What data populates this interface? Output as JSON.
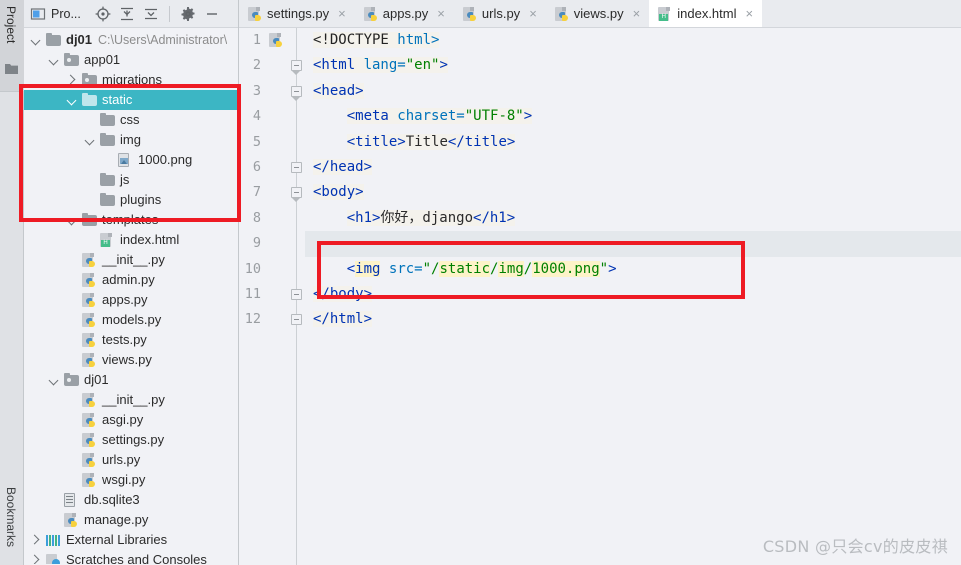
{
  "left_strip": {
    "project_label": "Project",
    "bookmarks_label": "Bookmarks",
    "folder_icon": "folder-icon"
  },
  "project_panel": {
    "title": "Pro...",
    "toolbar": [
      {
        "name": "project-view-icon",
        "glyph": "project-window-icon"
      },
      {
        "name": "select-opened-file-icon",
        "glyph": "target-icon"
      },
      {
        "name": "expand-all-icon",
        "glyph": "expand-all-icon"
      },
      {
        "name": "collapse-all-icon",
        "glyph": "collapse-all-icon"
      },
      {
        "name": "settings-icon",
        "glyph": "gear-icon"
      },
      {
        "name": "hide-icon",
        "glyph": "minimize-icon"
      }
    ],
    "tree": [
      {
        "label": "dj01",
        "sub": "C:\\Users\\Administrator\\",
        "indent": 0,
        "icon": "folder",
        "arrow": "down",
        "bold": true,
        "selected": false
      },
      {
        "label": "app01",
        "sub": "",
        "indent": 1,
        "icon": "folder-src",
        "arrow": "down",
        "bold": false,
        "selected": false
      },
      {
        "label": "migrations",
        "sub": "",
        "indent": 2,
        "icon": "folder-src",
        "arrow": "right",
        "bold": false,
        "selected": false
      },
      {
        "label": "static",
        "sub": "",
        "indent": 2,
        "icon": "folder",
        "arrow": "down",
        "bold": false,
        "selected": true
      },
      {
        "label": "css",
        "sub": "",
        "indent": 3,
        "icon": "folder",
        "arrow": "none",
        "bold": false,
        "selected": false
      },
      {
        "label": "img",
        "sub": "",
        "indent": 3,
        "icon": "folder",
        "arrow": "down",
        "bold": false,
        "selected": false
      },
      {
        "label": "1000.png",
        "sub": "",
        "indent": 4,
        "icon": "image",
        "arrow": "none",
        "bold": false,
        "selected": false
      },
      {
        "label": "js",
        "sub": "",
        "indent": 3,
        "icon": "folder",
        "arrow": "none",
        "bold": false,
        "selected": false
      },
      {
        "label": "plugins",
        "sub": "",
        "indent": 3,
        "icon": "folder",
        "arrow": "none",
        "bold": false,
        "selected": false
      },
      {
        "label": "templates",
        "sub": "",
        "indent": 2,
        "icon": "folder",
        "arrow": "down",
        "bold": false,
        "selected": false
      },
      {
        "label": "index.html",
        "sub": "",
        "indent": 3,
        "icon": "html",
        "arrow": "none",
        "bold": false,
        "selected": false
      },
      {
        "label": "__init__.py",
        "sub": "",
        "indent": 2,
        "icon": "python",
        "arrow": "none",
        "bold": false,
        "selected": false
      },
      {
        "label": "admin.py",
        "sub": "",
        "indent": 2,
        "icon": "python",
        "arrow": "none",
        "bold": false,
        "selected": false
      },
      {
        "label": "apps.py",
        "sub": "",
        "indent": 2,
        "icon": "python",
        "arrow": "none",
        "bold": false,
        "selected": false
      },
      {
        "label": "models.py",
        "sub": "",
        "indent": 2,
        "icon": "python",
        "arrow": "none",
        "bold": false,
        "selected": false
      },
      {
        "label": "tests.py",
        "sub": "",
        "indent": 2,
        "icon": "python",
        "arrow": "none",
        "bold": false,
        "selected": false
      },
      {
        "label": "views.py",
        "sub": "",
        "indent": 2,
        "icon": "python",
        "arrow": "none",
        "bold": false,
        "selected": false
      },
      {
        "label": "dj01",
        "sub": "",
        "indent": 1,
        "icon": "folder-src",
        "arrow": "down",
        "bold": false,
        "selected": false
      },
      {
        "label": "__init__.py",
        "sub": "",
        "indent": 2,
        "icon": "python",
        "arrow": "none",
        "bold": false,
        "selected": false
      },
      {
        "label": "asgi.py",
        "sub": "",
        "indent": 2,
        "icon": "python",
        "arrow": "none",
        "bold": false,
        "selected": false
      },
      {
        "label": "settings.py",
        "sub": "",
        "indent": 2,
        "icon": "python",
        "arrow": "none",
        "bold": false,
        "selected": false
      },
      {
        "label": "urls.py",
        "sub": "",
        "indent": 2,
        "icon": "python",
        "arrow": "none",
        "bold": false,
        "selected": false
      },
      {
        "label": "wsgi.py",
        "sub": "",
        "indent": 2,
        "icon": "python",
        "arrow": "none",
        "bold": false,
        "selected": false
      },
      {
        "label": "db.sqlite3",
        "sub": "",
        "indent": 1,
        "icon": "db",
        "arrow": "none",
        "bold": false,
        "selected": false
      },
      {
        "label": "manage.py",
        "sub": "",
        "indent": 1,
        "icon": "python",
        "arrow": "none",
        "bold": false,
        "selected": false
      },
      {
        "label": "External Libraries",
        "sub": "",
        "indent": 0,
        "icon": "library",
        "arrow": "right",
        "bold": false,
        "selected": false
      },
      {
        "label": "Scratches and Consoles",
        "sub": "",
        "indent": 0,
        "icon": "scratches",
        "arrow": "right",
        "bold": false,
        "selected": false
      }
    ]
  },
  "editor": {
    "tabs": [
      {
        "label": "settings.py",
        "icon": "python-file-icon",
        "active": false,
        "close": "×"
      },
      {
        "label": "apps.py",
        "icon": "python-file-icon",
        "active": false,
        "close": "×"
      },
      {
        "label": "urls.py",
        "icon": "python-file-icon",
        "active": false,
        "close": "×"
      },
      {
        "label": "views.py",
        "icon": "python-file-icon",
        "active": false,
        "close": "×"
      },
      {
        "label": "index.html",
        "icon": "html-file-icon",
        "active": true,
        "close": "×"
      }
    ],
    "line_numbers": [
      "1",
      "2",
      "3",
      "4",
      "5",
      "6",
      "7",
      "8",
      "9",
      "10",
      "11",
      "12"
    ],
    "current_line": 9,
    "code_lines": [
      {
        "n": 1,
        "tokens": [
          {
            "t": "<!DOCTYPE ",
            "c": "doctype softbg"
          },
          {
            "t": "html>",
            "c": "attr softbg"
          }
        ]
      },
      {
        "n": 2,
        "tokens": [
          {
            "t": "<html ",
            "c": "tag softbg"
          },
          {
            "t": "lang=",
            "c": "attr softbg"
          },
          {
            "t": "\"en\"",
            "c": "val softbg"
          },
          {
            "t": ">",
            "c": "tag softbg"
          }
        ]
      },
      {
        "n": 3,
        "tokens": [
          {
            "t": "<head>",
            "c": "tag softbg"
          }
        ]
      },
      {
        "n": 4,
        "tokens": [
          {
            "t": "    ",
            "c": "text"
          },
          {
            "t": "<meta ",
            "c": "tag softbg"
          },
          {
            "t": "charset=",
            "c": "attr softbg"
          },
          {
            "t": "\"UTF-8\"",
            "c": "val softbg"
          },
          {
            "t": ">",
            "c": "tag softbg"
          }
        ]
      },
      {
        "n": 5,
        "tokens": [
          {
            "t": "    ",
            "c": "text"
          },
          {
            "t": "<title>",
            "c": "tag softbg"
          },
          {
            "t": "Title",
            "c": "text softbg"
          },
          {
            "t": "</title>",
            "c": "tag softbg"
          }
        ]
      },
      {
        "n": 6,
        "tokens": [
          {
            "t": "</head>",
            "c": "tag softbg"
          }
        ]
      },
      {
        "n": 7,
        "tokens": [
          {
            "t": "<body>",
            "c": "tag softbg"
          }
        ]
      },
      {
        "n": 8,
        "tokens": [
          {
            "t": "    ",
            "c": "text"
          },
          {
            "t": "<h1>",
            "c": "tag softbg"
          },
          {
            "t": "你好，django",
            "c": "text softbg"
          },
          {
            "t": "</h1>",
            "c": "tag softbg"
          }
        ]
      },
      {
        "n": 9,
        "tokens": [
          {
            "t": "",
            "c": "text"
          }
        ]
      },
      {
        "n": 10,
        "tokens": [
          {
            "t": "    ",
            "c": "text"
          },
          {
            "t": "<",
            "c": "tag"
          },
          {
            "t": "img",
            "c": "tag hl"
          },
          {
            "t": " ",
            "c": "text"
          },
          {
            "t": "src=",
            "c": "attr"
          },
          {
            "t": "\"/",
            "c": "val"
          },
          {
            "t": "static",
            "c": "val hl"
          },
          {
            "t": "/",
            "c": "val"
          },
          {
            "t": "img",
            "c": "val hl"
          },
          {
            "t": "/",
            "c": "val"
          },
          {
            "t": "1000.png",
            "c": "val hl"
          },
          {
            "t": "\"",
            "c": "val"
          },
          {
            "t": ">",
            "c": "tag"
          }
        ]
      },
      {
        "n": 11,
        "tokens": [
          {
            "t": "</body>",
            "c": "tag softbg"
          }
        ]
      },
      {
        "n": 12,
        "tokens": [
          {
            "t": "</html>",
            "c": "tag softbg"
          }
        ]
      }
    ]
  },
  "annotations": {
    "tree_box_color": "#ee1b24",
    "code_box_color": "#ee1b24",
    "selection_color": "#3cb6c4",
    "highlight_color": "#fdf3c8"
  },
  "watermark": {
    "text": "CSDN @只会cv的皮皮祺"
  }
}
